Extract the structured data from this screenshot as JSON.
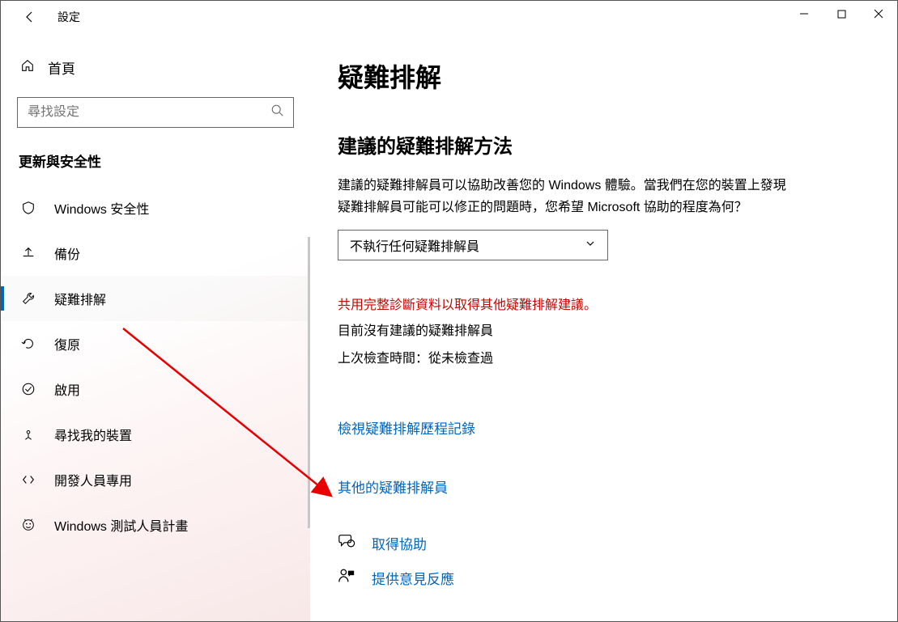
{
  "window": {
    "title": "設定"
  },
  "sidebar": {
    "home": "首頁",
    "search_placeholder": "尋找設定",
    "section": "更新與安全性",
    "items": [
      {
        "label": "Windows 安全性"
      },
      {
        "label": "備份"
      },
      {
        "label": "疑難排解"
      },
      {
        "label": "復原"
      },
      {
        "label": "啟用"
      },
      {
        "label": "尋找我的裝置"
      },
      {
        "label": "開發人員專用"
      },
      {
        "label": "Windows 測試人員計畫"
      }
    ]
  },
  "content": {
    "title": "疑難排解",
    "subtitle": "建議的疑難排解方法",
    "description": "建議的疑難排解員可以協助改善您的 Windows 體驗。當我們在您的裝置上發現疑難排解員可能可以修正的問題時，您希望 Microsoft 協助的程度為何？",
    "dropdown_value": "不執行任何疑難排解員",
    "diag_warning": "共用完整診斷資料以取得其他疑難排解建議。",
    "no_recommend": "目前沒有建議的疑難排解員",
    "last_check": "上次檢查時間：從未檢查過",
    "history_link": "檢視疑難排解歷程記錄",
    "additional_link": "其他的疑難排解員",
    "get_help": "取得協助",
    "feedback": "提供意見反應"
  }
}
